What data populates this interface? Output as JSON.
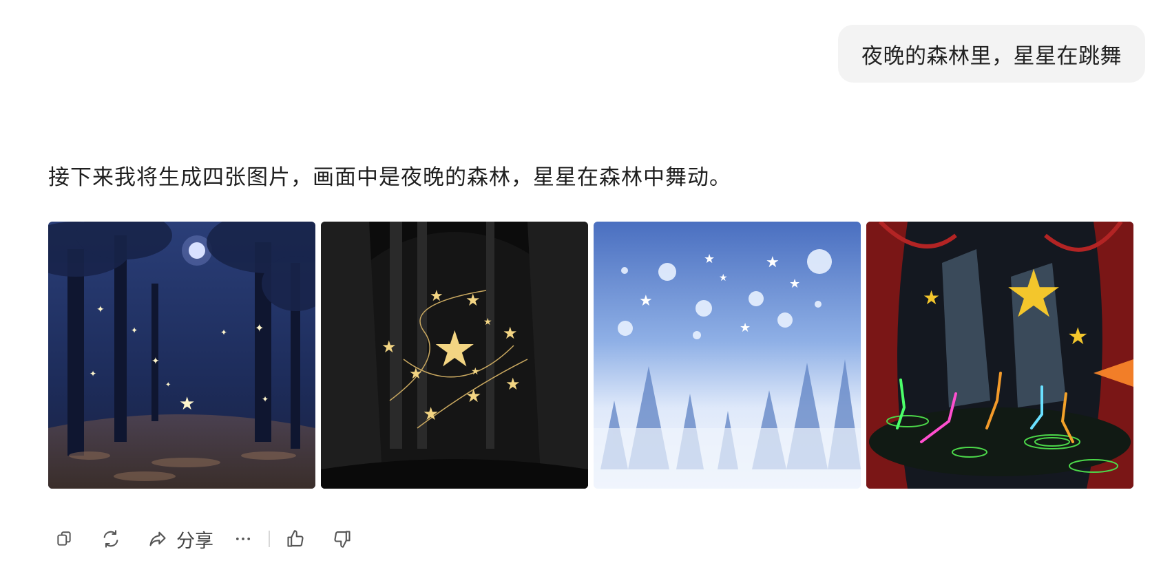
{
  "user_message": "夜晚的森林里，星星在跳舞",
  "assistant_message": "接下来我将生成四张图片，画面中是夜晚的森林，星星在森林中舞动。",
  "images": [
    {
      "style": "realistic-blue-forest"
    },
    {
      "style": "black-gold-illustration"
    },
    {
      "style": "misty-blue-watercolor"
    },
    {
      "style": "neon-comic-fantasy"
    }
  ],
  "toolbar": {
    "copy_icon": "copy-icon",
    "regenerate_icon": "refresh-icon",
    "share_icon": "share-icon",
    "share_label": "分享",
    "more_icon": "more-icon",
    "like_icon": "thumbs-up-icon",
    "dislike_icon": "thumbs-down-icon"
  },
  "colors": {
    "bubble_bg": "#f3f3f3",
    "text": "#1f1f1f",
    "icon": "#555555"
  }
}
